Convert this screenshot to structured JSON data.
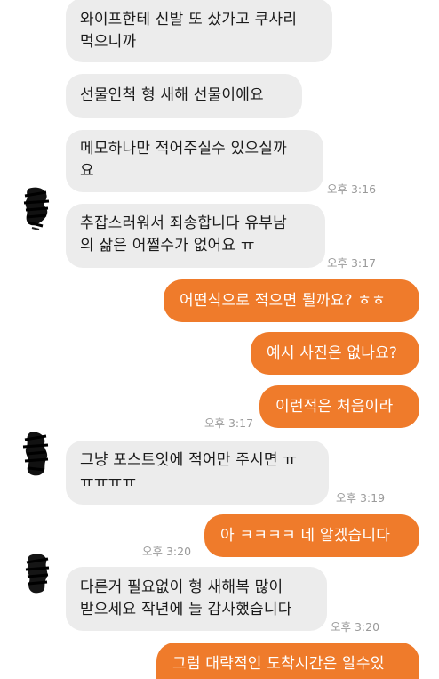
{
  "messages": [
    {
      "text": "와이프한테 신발 또 샀가고 쿠사리\n먹으니까"
    },
    {
      "text": "선물인척 형 새해 선물이에요"
    },
    {
      "text": "메모하나만 적어주실수 있으실까\n요",
      "time": "오후 3:16"
    },
    {
      "text": "추잡스러워서 죄송합니다 유부남\n의 삶은 어쩔수가 없어요 ㅠ",
      "time": "오후 3:17"
    },
    {
      "text": "어떤식으로 적으면 될까요? ㅎㅎ"
    },
    {
      "text": "예시 사진은 없나요?"
    },
    {
      "text": "이런적은 처음이라",
      "time": "오후 3:17"
    },
    {
      "text": "그냥 포스트잇에 적어만 주시면 ㅠ\nㅠㅠㅠㅠ",
      "time": "오후 3:19"
    },
    {
      "text": "아 ㅋㅋㅋㅋ 네 알겠습니다",
      "time": "오후 3:20"
    },
    {
      "text": "다른거 필요없이 형 새해복 많이\n받으세요 작년에 늘 감사했습니다",
      "time": "오후 3:20"
    },
    {
      "text": "그럼 대략적인 도착시간은 알수있"
    }
  ],
  "colors": {
    "outgoing_bubble": "#ef7b2b",
    "incoming_bubble": "#ececec",
    "timestamp": "#9a9a9a"
  }
}
